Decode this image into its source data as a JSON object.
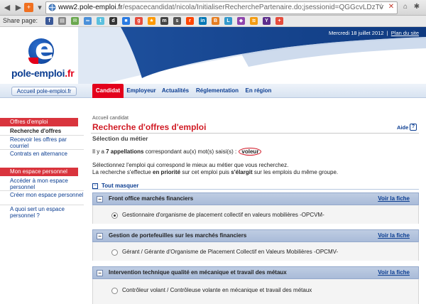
{
  "browser": {
    "url_host": "www2.pole-emploi.fr",
    "url_path": "/espacecandidat/nicola/InitialiserRecherchePartenaire.do;jsessionid=QGGcvLDzTv"
  },
  "share": {
    "label": "Share page:"
  },
  "header": {
    "date": "Mercredi 18 juillet 2012",
    "sitemap": "Plan du site",
    "logo_text": "pole-emploi",
    "logo_ext": ".fr"
  },
  "nav": {
    "home": "Accueil pole-emploi.fr",
    "tabs": [
      "Candidat",
      "Employeur",
      "Actualités",
      "Réglementation",
      "En région"
    ]
  },
  "sidebar": {
    "section1": "Offres d'emploi",
    "items1": [
      "Recherche d'offres",
      "Recevoir les offres par courriel",
      "Contrats en alternance"
    ],
    "section2": "Mon espace personnel",
    "items2": [
      "Accéder à mon espace personnel",
      "Créer mon espace personnel",
      "A quoi sert un espace personnel ?"
    ]
  },
  "main": {
    "breadcrumb": "Accueil candidat",
    "title": "Recherche d'offres d'emploi",
    "help": "Aide",
    "subtitle": "Sélection du métier",
    "result_pre": "Il y a ",
    "result_count": "7 appellations",
    "result_mid": " correspondant au(x) mot(s) saisi(s) :",
    "keyword": "voleur",
    "instr1": "Sélectionnez l'emploi qui correspond le mieux au métier que vous recherchez.",
    "instr2_pre": "La recherche s'effectue ",
    "instr2_b1": "en priorité",
    "instr2_mid": " sur cet emploi puis ",
    "instr2_b2": "s'élargit",
    "instr2_post": " sur les emplois du même groupe.",
    "collapse_all": "Tout masquer",
    "see_sheet": "Voir la fiche",
    "groups": [
      {
        "title": "Front office marchés financiers",
        "option": "Gestionnaire d'organisme de placement collectif en valeurs mobilières -OPCVM-",
        "selected": true
      },
      {
        "title": "Gestion de portefeuilles sur les marchés financiers",
        "option": "Gérant / Gérante d'Organisme de Placement Collectif en Valeurs Mobilières -OPCMV-",
        "selected": false
      },
      {
        "title": "Intervention technique qualité en mécanique et travail des métaux",
        "option": "Contrôleur volant / Contrôleuse volante en mécanique et travail des métaux",
        "selected": false
      }
    ]
  }
}
